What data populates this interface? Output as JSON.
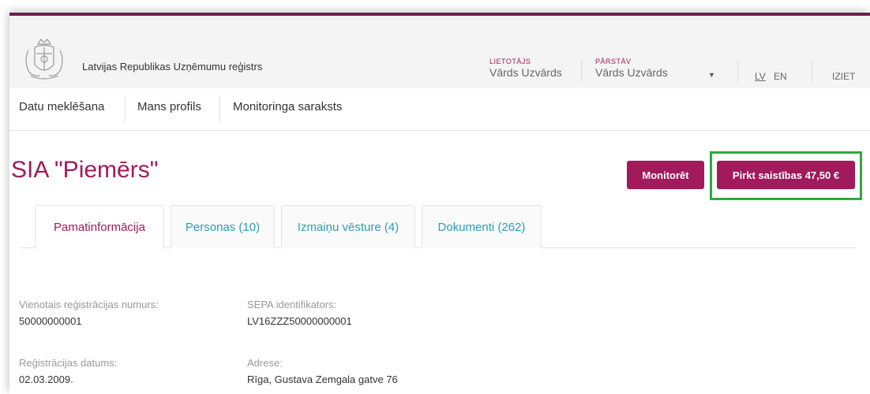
{
  "header": {
    "org_name": "Latvijas Republikas Uzņēmumu reģistrs",
    "user_label": "LIETOTĀJS",
    "user_name": "Vārds Uzvārds",
    "rep_label": "PĀRSTĀV",
    "rep_name": "Vārds Uzvārds",
    "dropdown_icon": "chevron-down-icon",
    "lang_lv": "LV",
    "lang_en": "EN",
    "logout": "IZIET"
  },
  "nav": {
    "items": [
      "Datu meklēšana",
      "Mans profils",
      "Monitoringa saraksts"
    ]
  },
  "company": {
    "title": "SIA \"Piemērs\"",
    "monitor_button": "Monitorēt",
    "buy_button": "Pirkt saistības 47,50 €"
  },
  "tabs": [
    {
      "label": "Pamatinformācija",
      "active": true
    },
    {
      "label": "Personas (10)",
      "active": false
    },
    {
      "label": "Izmaiņu vēsture (4)",
      "active": false
    },
    {
      "label": "Dokumenti (262)",
      "active": false
    }
  ],
  "fields": {
    "reg_number_label": "Vienotais reģistrācijas numurs:",
    "reg_number_value": "50000000001",
    "sepa_label": "SEPA identifikators:",
    "sepa_value": "LV16ZZZ50000000001",
    "reg_date_label": "Reģistrācijas datums:",
    "reg_date_value": "02.03.2009.",
    "address_label": "Adrese:",
    "address_value": "Rīga, Gustava Zemgala gatve 76"
  },
  "colors": {
    "accent": "#a3195b",
    "button": "#a01a5c",
    "tab_link": "#2a9fb5",
    "highlight": "#2eaa3d"
  }
}
